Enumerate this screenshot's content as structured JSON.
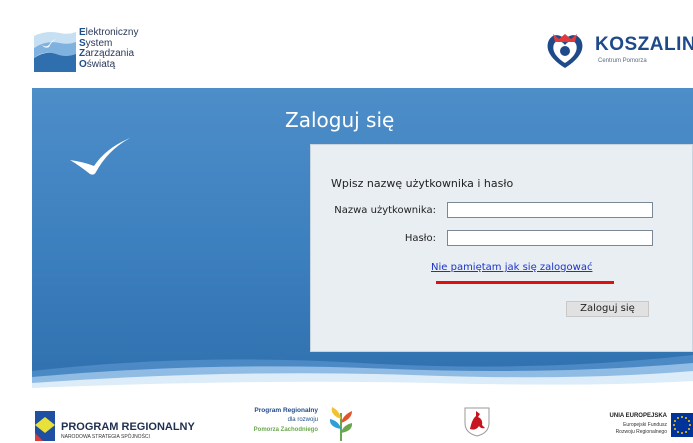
{
  "header": {
    "logo_left": {
      "lines": [
        {
          "cap": "E",
          "rest": "lektroniczny"
        },
        {
          "cap": "S",
          "rest": "ystem"
        },
        {
          "cap": "Z",
          "rest": "arządzania"
        },
        {
          "cap": "O",
          "rest": "światą"
        }
      ]
    },
    "logo_right": {
      "title": "KOSZALIN",
      "subtitle": "Centrum Pomorza"
    }
  },
  "login": {
    "title": "Zaloguj się",
    "instruction": "Wpisz nazwę użytkownika i hasło",
    "username_label": "Nazwa użytkownika:",
    "username_value": "",
    "password_label": "Hasło:",
    "password_value": "",
    "forgot_link": "Nie pamiętam jak się zalogować",
    "submit_label": "Zaloguj się"
  },
  "footer": {
    "program_regionalny": {
      "title": "PROGRAM REGIONALNY",
      "subtitle": "NARODOWA STRATEGIA SPÓJNOŚCI"
    },
    "program_pomorze": {
      "line1": "Program Regionalny",
      "line2": "dla rozwoju",
      "line3": "Pomorza Zachodniego"
    },
    "eu": {
      "line1": "UNIA EUROPEJSKA",
      "line2": "Europejski Fundusz",
      "line3": "Rozwoju Regionalnego"
    }
  },
  "colors": {
    "banner": "#3c7fbe",
    "panel": "#e9eef3",
    "link": "#1a34c8",
    "highlight": "#e20e0e"
  },
  "icons": {
    "bird": "bird-icon",
    "heart_logo": "koszalin-heart-icon",
    "crest": "griffin-crest-icon",
    "eu_flag": "eu-flag-icon"
  }
}
